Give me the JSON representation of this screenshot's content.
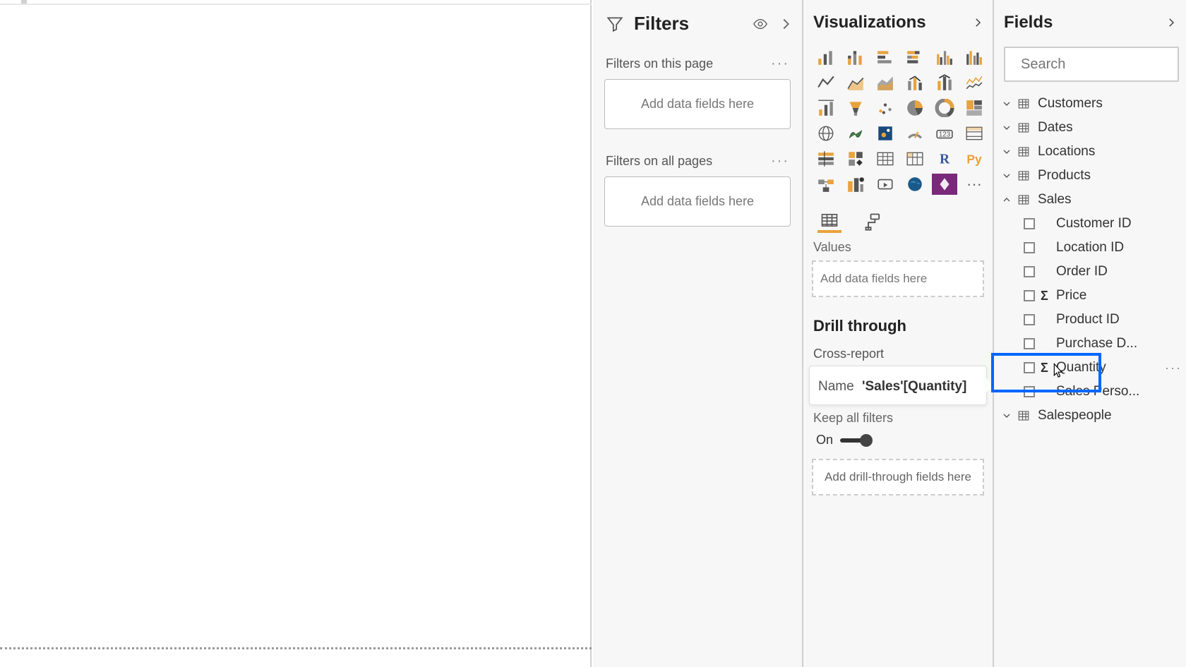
{
  "filters": {
    "title": "Filters",
    "pageLabel": "Filters on this page",
    "allLabel": "Filters on all pages",
    "dropText": "Add data fields here"
  },
  "viz": {
    "title": "Visualizations",
    "valuesLabel": "Values",
    "valuesDrop": "Add data fields here",
    "drillTitle": "Drill through",
    "crossReport": "Cross-report",
    "keepFilters": "Keep all filters",
    "toggleState": "On",
    "drillDrop": "Add drill-through fields here",
    "tooltip": {
      "name": "Name",
      "value": "'Sales'[Quantity]"
    }
  },
  "fields": {
    "title": "Fields",
    "searchPlaceholder": "Search",
    "tables": [
      {
        "name": "Customers",
        "expanded": false,
        "fields": []
      },
      {
        "name": "Dates",
        "expanded": false,
        "fields": []
      },
      {
        "name": "Locations",
        "expanded": false,
        "fields": []
      },
      {
        "name": "Products",
        "expanded": false,
        "fields": []
      },
      {
        "name": "Sales",
        "expanded": true,
        "fields": [
          {
            "name": "Customer ID",
            "agg": false
          },
          {
            "name": "Location ID",
            "agg": false
          },
          {
            "name": "Order ID",
            "agg": false
          },
          {
            "name": "Price",
            "agg": true
          },
          {
            "name": "Product ID",
            "agg": false
          },
          {
            "name": "Purchase D...",
            "agg": false
          },
          {
            "name": "Quantity",
            "agg": true,
            "highlight": true
          },
          {
            "name": "Sales Perso...",
            "agg": false
          }
        ]
      },
      {
        "name": "Salespeople",
        "expanded": false,
        "fields": []
      }
    ]
  }
}
